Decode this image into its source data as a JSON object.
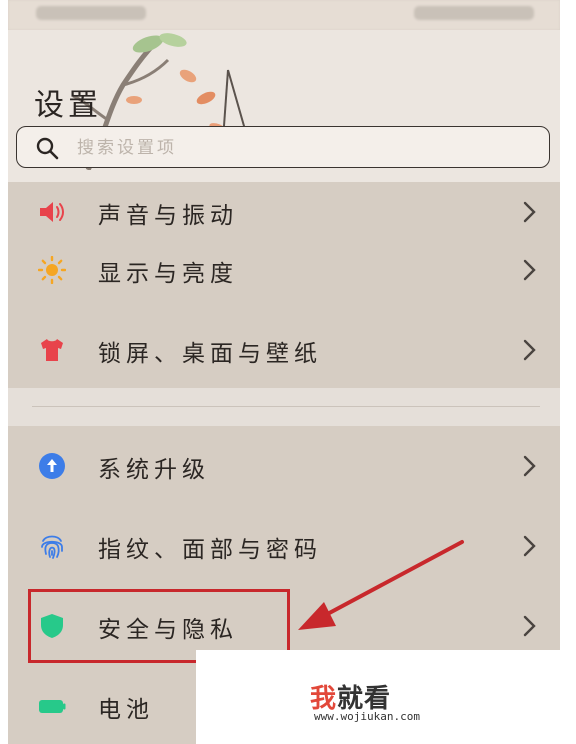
{
  "header": {
    "title": "设置"
  },
  "search": {
    "placeholder": "搜索设置项"
  },
  "group1": [
    {
      "label": "声音与振动",
      "icon": "speaker-icon",
      "color": "#e8434b"
    },
    {
      "label": "显示与亮度",
      "icon": "sun-icon",
      "color": "#f5a623"
    },
    {
      "label": "锁屏、桌面与壁纸",
      "icon": "shirt-icon",
      "color": "#e8434b"
    }
  ],
  "group2": [
    {
      "label": "系统升级",
      "icon": "upgrade-arrow-icon",
      "color": "#3d7de8"
    },
    {
      "label": "指纹、面部与密码",
      "icon": "fingerprint-icon",
      "color": "#3d7de8"
    },
    {
      "label": "安全与隐私",
      "icon": "shield-icon",
      "color": "#27c98a"
    },
    {
      "label": "电池",
      "icon": "battery-icon",
      "color": "#27c98a"
    }
  ],
  "watermark": {
    "first_char": "我",
    "rest": "就看",
    "url": "www.wojiukan.com"
  },
  "colors": {
    "highlight": "#c8282c",
    "background": "#d6cdc3"
  }
}
